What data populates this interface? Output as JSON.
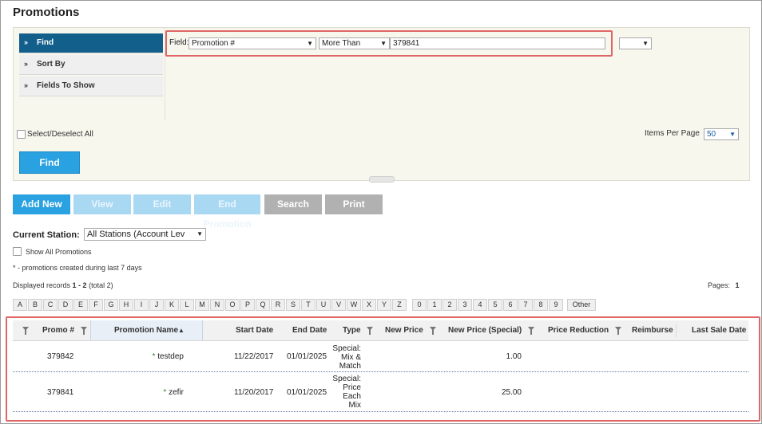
{
  "page": {
    "title": "Promotions"
  },
  "search_panel": {
    "menu": [
      {
        "label": "Find",
        "active": true
      },
      {
        "label": "Sort By",
        "active": false
      },
      {
        "label": "Fields To Show",
        "active": false
      }
    ],
    "menu_arrow": "»",
    "field_label": "Field:",
    "field_select": "Promotion #",
    "operator_select": "More Than",
    "value_input": "379841",
    "extra_select": "",
    "select_all_label": "Select/Deselect All",
    "items_per_page_label": "Items Per Page",
    "items_per_page_value": "50",
    "find_button": "Find"
  },
  "actions": {
    "add_new": "Add New",
    "view": "View",
    "edit": "Edit",
    "end_promotion": "End Promotion",
    "search": "Search",
    "print": "Print"
  },
  "station": {
    "label": "Current Station:",
    "value": "All Stations (Account Lev",
    "show_all_label": "Show All Promotions",
    "note": "* - promotions created during last 7 days"
  },
  "records": {
    "displayed_prefix": "Displayed records",
    "displayed_range": "1 - 2",
    "displayed_total": "(total 2)",
    "pages_label": "Pages:",
    "pages_value": "1"
  },
  "alphabet": [
    "A",
    "B",
    "C",
    "D",
    "E",
    "F",
    "G",
    "H",
    "I",
    "J",
    "K",
    "L",
    "M",
    "N",
    "O",
    "P",
    "Q",
    "R",
    "S",
    "T",
    "U",
    "V",
    "W",
    "X",
    "Y",
    "Z",
    "0",
    "1",
    "2",
    "3",
    "4",
    "5",
    "6",
    "7",
    "8",
    "9",
    "Other"
  ],
  "table": {
    "columns": {
      "promo": "Promo #",
      "name": "Promotion Name",
      "start": "Start Date",
      "end": "End Date",
      "type": "Type",
      "new_price": "New Price",
      "new_price_special": "New Price (Special)",
      "price_reduction": "Price Reduction",
      "reimburse": "Reimburse",
      "last_sale": "Last Sale Date"
    },
    "sort_arrow": "▲",
    "rows": [
      {
        "promo": "379842",
        "star": "*",
        "name": "testdep",
        "start": "11/22/2017",
        "end": "01/01/2025",
        "type_lines": [
          "Special:",
          "Mix &",
          "Match"
        ],
        "new_price": "",
        "new_price_special": "1.00",
        "price_reduction": "",
        "reimburse": "",
        "last_sale": ""
      },
      {
        "promo": "379841",
        "star": "*",
        "name": "zefir",
        "start": "11/20/2017",
        "end": "01/01/2025",
        "type_lines": [
          "Special:",
          "Price",
          "Each",
          "Mix"
        ],
        "new_price": "",
        "new_price_special": "25.00",
        "price_reduction": "",
        "reimburse": "",
        "last_sale": ""
      }
    ]
  },
  "colors": {
    "accent_blue": "#2aa1e0",
    "menu_active": "#135f8c",
    "highlight_red": "#e06666",
    "disabled_blue": "#a9d8f3",
    "gray_button": "#b1b1b1"
  }
}
